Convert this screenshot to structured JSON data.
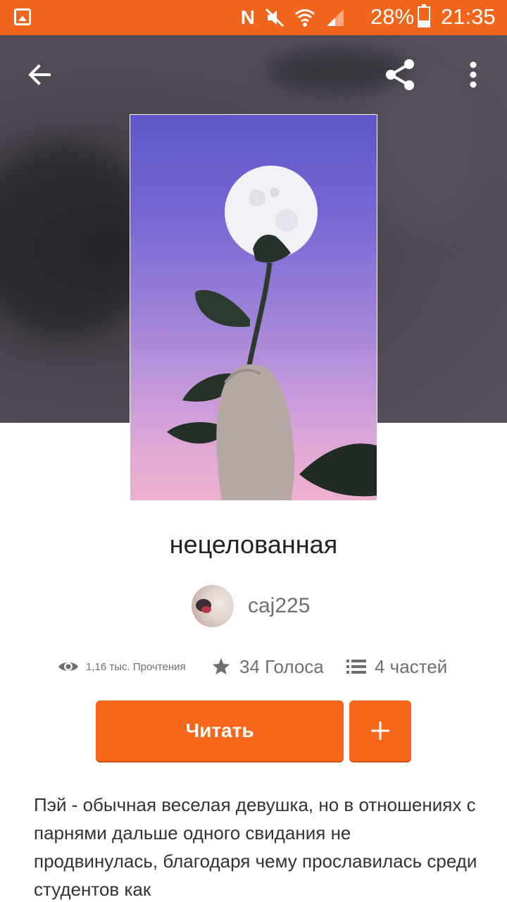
{
  "status_bar": {
    "battery": "28%",
    "time": "21:35",
    "icons": [
      "gallery-notification-icon",
      "nfc-icon",
      "mute-icon",
      "wifi-icon",
      "signal-icon",
      "battery-icon"
    ]
  },
  "toolbar": {
    "back_icon": "arrow-back-icon",
    "share_icon": "share-icon",
    "more_icon": "more-vert-icon"
  },
  "story": {
    "title": "нецелованная",
    "author": "caj225",
    "reads": "1,16 тыс. Прочтения",
    "votes": "34 Голоса",
    "parts": "4 частей",
    "read_label": "Читать",
    "description": "Пэй - обычная веселая девушка, но в отношениях с парнями дальше одного свидания не продвинулась, благодаря чему прославилась среди студентов как"
  },
  "colors": {
    "accent": "#f8671c",
    "status_bar": "#f1641b",
    "hero_bg": "#4f4a55"
  }
}
